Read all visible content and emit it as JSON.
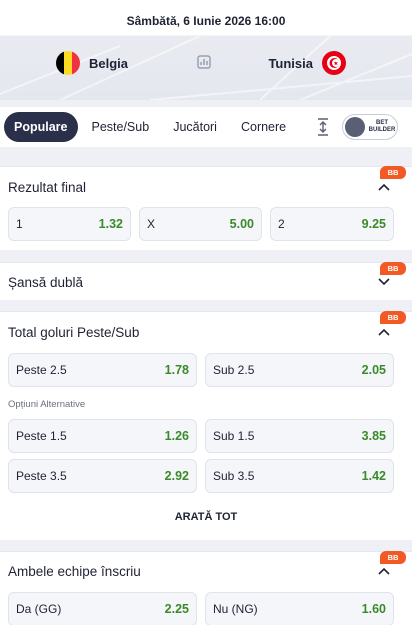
{
  "header": {
    "date": "Sâmbătă, 6 Iunie 2026 16:00",
    "home_team": "Belgia",
    "away_team": "Tunisia",
    "home_flag_colors": [
      "#000000",
      "#FDDA24",
      "#EF3340"
    ],
    "away_flag_color": "#E70013"
  },
  "tabs": [
    {
      "label": "Populare",
      "active": true
    },
    {
      "label": "Peste/Sub",
      "active": false
    },
    {
      "label": "Jucători",
      "active": false
    },
    {
      "label": "Cornere",
      "active": false
    }
  ],
  "bet_builder": {
    "label_line1": "BET",
    "label_line2": "BUILDER",
    "enabled": false
  },
  "badge": "BB",
  "markets": {
    "rezultat_final": {
      "title": "Rezultat final",
      "expanded": true,
      "odds": [
        {
          "label": "1",
          "value": "1.32"
        },
        {
          "label": "X",
          "value": "5.00"
        },
        {
          "label": "2",
          "value": "9.25"
        }
      ]
    },
    "sansa_dubla": {
      "title": "Șansă dublă",
      "expanded": false
    },
    "total_goluri": {
      "title": "Total goluri Peste/Sub",
      "expanded": true,
      "main": [
        {
          "label": "Peste 2.5",
          "value": "1.78"
        },
        {
          "label": "Sub 2.5",
          "value": "2.05"
        }
      ],
      "alt_title": "Opțiuni Alternative",
      "alternatives": [
        {
          "label": "Peste 1.5",
          "value": "1.26"
        },
        {
          "label": "Sub 1.5",
          "value": "3.85"
        },
        {
          "label": "Peste 3.5",
          "value": "2.92"
        },
        {
          "label": "Sub 3.5",
          "value": "1.42"
        }
      ],
      "show_all": "ARATĂ TOT"
    },
    "ambele_inscriu": {
      "title": "Ambele echipe înscriu",
      "expanded": true,
      "odds": [
        {
          "label": "Da (GG)",
          "value": "2.25"
        },
        {
          "label": "Nu (NG)",
          "value": "1.60"
        }
      ]
    }
  },
  "colors": {
    "accent": "#2A2F4A",
    "odds_value": "#3A8A2B",
    "badge": "#F15A24"
  }
}
